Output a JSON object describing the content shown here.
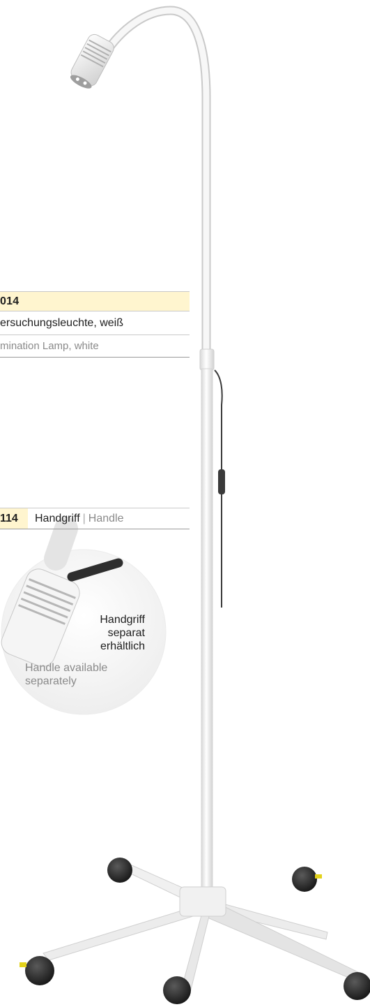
{
  "products": {
    "lamp": {
      "article_number": "014",
      "name_de": "ersuchungsleuchte, weiß",
      "name_en": "mination Lamp, white"
    },
    "handle": {
      "article_number": "114",
      "name_de": "Handgriff",
      "separator": "|",
      "name_en": "Handle"
    }
  },
  "callout": {
    "text_de": "Handgriff\nseparat\nerhältlich",
    "text_en": "Handle available\nseparately"
  },
  "colors": {
    "highlight": "#fff5cf",
    "lamp_body": "#f4f4f4",
    "wheel": "#2a2a2a",
    "cable": "#3a3a3a",
    "brake_accent": "#e3d21b"
  },
  "icons": {
    "product": "examination-lamp-illustration",
    "detail": "lamp-head-detail-magnifier"
  }
}
